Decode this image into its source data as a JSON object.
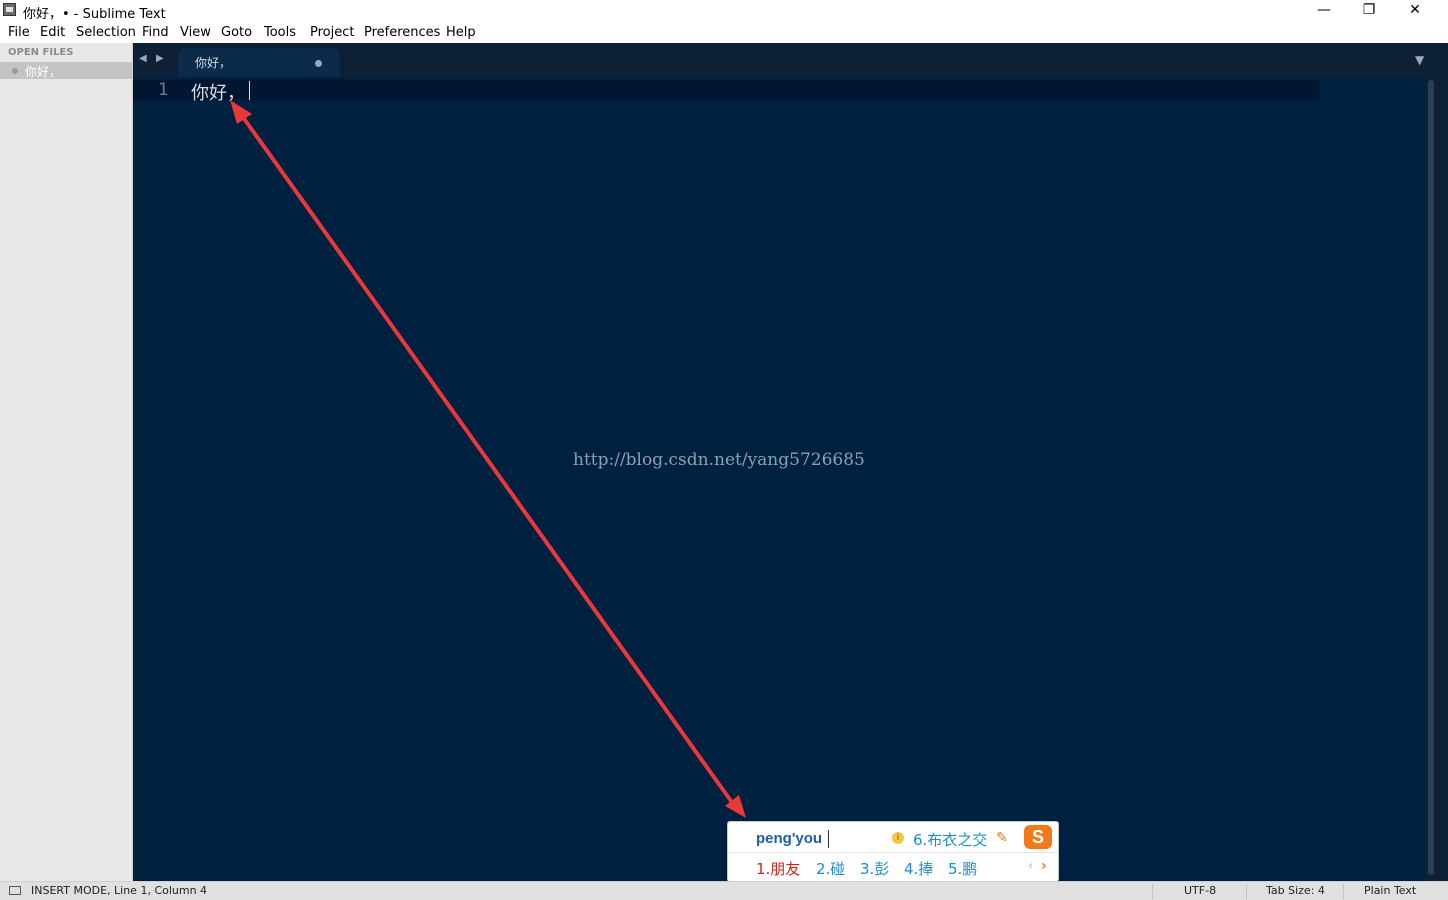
{
  "window": {
    "title": "你好，• - Sublime Text",
    "minimize_glyph": "—",
    "maximize_glyph": "❐",
    "close_glyph": "✕"
  },
  "menu": [
    "File",
    "Edit",
    "Selection",
    "Find",
    "View",
    "Goto",
    "Tools",
    "Project",
    "Preferences",
    "Help"
  ],
  "sidebar": {
    "header": "OPEN FILES",
    "files": [
      {
        "name": "你好，"
      }
    ]
  },
  "tabbar": {
    "back_glyph": "◀",
    "forward_glyph": "▶",
    "dropdown_glyph": "▼",
    "tabs": [
      {
        "label": "你好，",
        "dirty": true
      }
    ]
  },
  "editor": {
    "lines": [
      {
        "number": "1",
        "text": "你好，"
      }
    ],
    "watermark": "http://blog.csdn.net/yang5726685",
    "colors": {
      "background": "#002040",
      "line_highlight": "#001631",
      "text": "#d6dde5"
    }
  },
  "ime": {
    "input": "peng'you",
    "extra_candidate": "6.布衣之交",
    "logo": "S",
    "candidates": [
      "1.朋友",
      "2.碰",
      "3.彭",
      "4.捧",
      "5.鹏"
    ],
    "prev_glyph": "‹",
    "next_glyph": "›",
    "icons": [
      "info-icon",
      "pen-icon",
      "sogou-logo-icon"
    ]
  },
  "annotation": {
    "color": "#e8383a",
    "shape": "double-headed-arrow"
  },
  "status": {
    "mode": "INSERT MODE, Line 1, Column 4",
    "encoding": "UTF-8",
    "tab_size": "Tab Size: 4",
    "syntax": "Plain Text"
  }
}
